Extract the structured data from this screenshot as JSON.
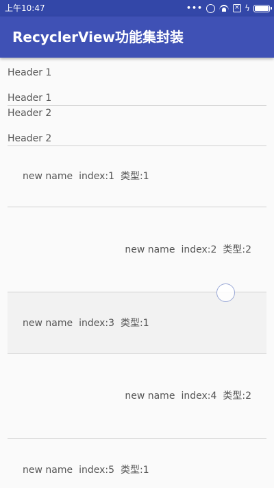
{
  "status_bar": {
    "time": "上午10:47",
    "icons": [
      "more-dots-icon",
      "alarm-icon",
      "wifi-icon",
      "no-sim-icon",
      "charging-icon",
      "battery-icon"
    ]
  },
  "toolbar": {
    "title": "RecyclerView功能集封装",
    "background": "#3f51b5",
    "status_bar_color": "#3347a8"
  },
  "headers": [
    {
      "label": "Header 1"
    },
    {
      "label": "Header 1"
    },
    {
      "label": "Header 2"
    },
    {
      "label": "Header 2"
    }
  ],
  "items": [
    {
      "name": "new name",
      "index": "index:1",
      "type": "类型:1"
    },
    {
      "name": "new name",
      "index": "index:2",
      "type": "类型:2"
    },
    {
      "name": "new name",
      "index": "index:3",
      "type": "类型:1"
    },
    {
      "name": "new name",
      "index": "index:4",
      "type": "类型:2"
    },
    {
      "name": "new name",
      "index": "index:5",
      "type": "类型:1"
    }
  ]
}
